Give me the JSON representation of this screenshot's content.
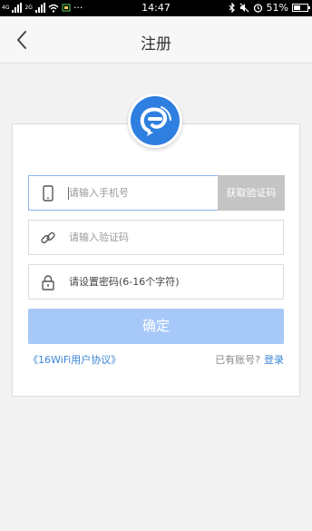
{
  "status_bar": {
    "network_4g": "4G",
    "network_2g": "2G",
    "more": "···",
    "time": "14:47",
    "battery": "51%",
    "battery_level": 0.51
  },
  "nav": {
    "back_icon": "chevron-left-icon",
    "title": "注册"
  },
  "logo": {
    "icon": "wifi-pin-logo",
    "color": "#2f7fe0"
  },
  "form": {
    "phone": {
      "icon": "phone-icon",
      "placeholder": "请输入手机号",
      "value": ""
    },
    "get_code_label": "获取验证码",
    "code": {
      "icon": "link-icon",
      "placeholder": "请输入验证码",
      "value": ""
    },
    "password": {
      "icon": "lock-icon",
      "placeholder": "请设置密码(6-16个字符)",
      "value": ""
    },
    "confirm_label": "确定"
  },
  "footer": {
    "agreement": "《16WiFi用户协议》",
    "has_account": "已有账号?",
    "login": "登录"
  },
  "colors": {
    "accent": "#3a86d6",
    "confirm_disabled": "#a7c9f9",
    "get_code_disabled": "#c4c4c4"
  }
}
